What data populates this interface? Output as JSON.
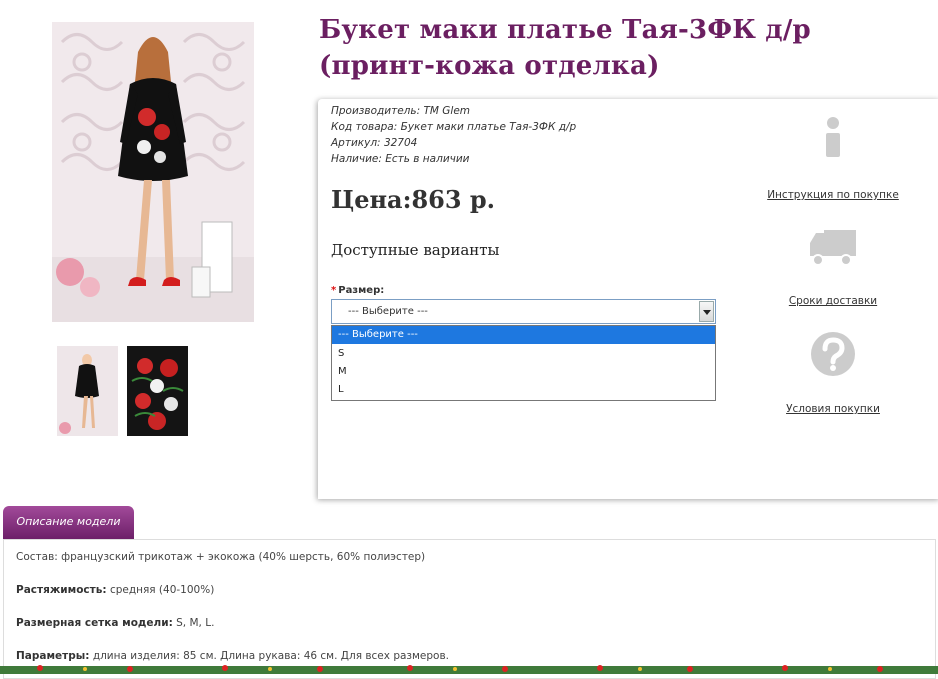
{
  "product": {
    "title": "Букет маки платье Тая-3ФК д/р (принт-кожа отделка)",
    "manufacturer_label": "Производитель:",
    "manufacturer": "TM Glem",
    "code_label": "Код товара:",
    "code": "Букет маки платье Тая-3ФК д/р",
    "article_label": "Артикул:",
    "article": "32704",
    "availability_label": "Наличие:",
    "availability": "Есть в наличии",
    "price": "Цена:863 р.",
    "variants_heading": "Доступные варианты"
  },
  "size_select": {
    "label": "Размер:",
    "required_mark": "*",
    "value": "--- Выберите ---",
    "options": [
      "--- Выберите ---",
      "S",
      "M",
      "L"
    ]
  },
  "side_links": [
    {
      "icon": "info-icon",
      "label": "Инструкция по покупке"
    },
    {
      "icon": "truck-icon",
      "label": "Сроки доставки"
    },
    {
      "icon": "question-icon",
      "label": "Условия покупки"
    }
  ],
  "tabs": [
    {
      "label": "Описание модели"
    }
  ],
  "description": {
    "composition_key": "Состав:",
    "composition": "французский трикотаж + экокожа (40% шерсть, 60% полиэстер)",
    "stretch_key": "Растяжимость:",
    "stretch": "средняя (40-100%)",
    "sizes_key": "Размерная сетка модели:",
    "sizes": "S, M, L.",
    "params_key": "Параметры:",
    "params": "длина изделия: 85 см. Длина рукава: 46 см. Для всех размеров."
  },
  "colors": {
    "title": "#6b1f61",
    "tab": "#8a3382",
    "selected_option": "#1e78e0",
    "required": "#dd1111"
  }
}
